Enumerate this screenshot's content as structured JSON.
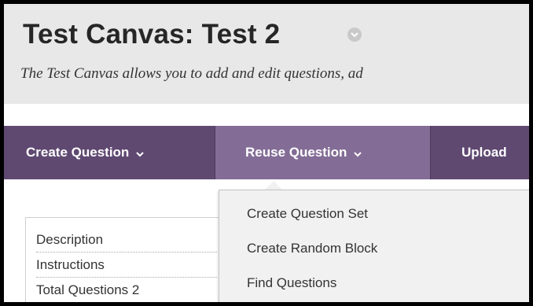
{
  "page": {
    "title": "Test Canvas: Test 2",
    "subtitle": "The Test Canvas allows you to add and edit questions, ad"
  },
  "icons": {
    "title_menu": "chevron-down-circle-icon",
    "menu_chevron": "chevron-down-icon"
  },
  "action_bar": {
    "create_question": "Create Question",
    "reuse_question": "Reuse Question",
    "upload": "Upload"
  },
  "dropdown": {
    "items": [
      "Create Question Set",
      "Create Random Block",
      "Find Questions"
    ]
  },
  "details": {
    "description_label": "Description",
    "instructions_label": "Instructions",
    "total_questions_label": "Total Questions",
    "total_questions_value": "2"
  },
  "colors": {
    "action_bar": "#5f4971",
    "action_bar_active": "#836c96",
    "header_bg": "#e8e8e8",
    "dropdown_bg": "#f1f1f1"
  }
}
